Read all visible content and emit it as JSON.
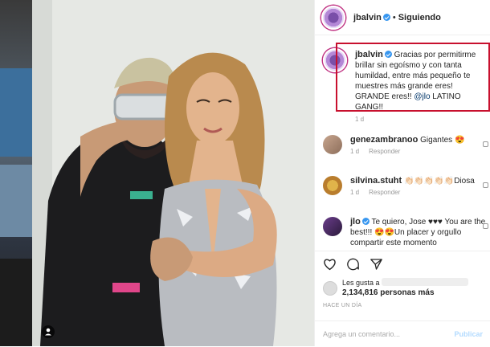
{
  "header": {
    "username": "jbalvin",
    "separator": "•",
    "follow_status": "Siguiendo"
  },
  "caption": {
    "username": "jbalvin",
    "text_before": "Gracias por permitirme brillar sin egoísmo y con tanta humildad, entre más pequeño te muestres más grande eres! GRANDE eres!! ",
    "mention": "@jlo",
    "text_after": " LATINO GANG!!",
    "time": "1 d"
  },
  "comments": [
    {
      "username": "genezambranoo",
      "text": "Gigantes 😍",
      "time": "1 d",
      "reply": "Responder"
    },
    {
      "username": "silvina.stuht",
      "text": "👏🏻👏🏻👏🏻👏🏻👏🏻Diosa",
      "time": "1 d",
      "reply": "Responder"
    },
    {
      "username": "jlo",
      "text": "Te quiero, Jose ♥♥♥ You are the best!!! 😍😍Un placer y orgullo compartir este momento"
    }
  ],
  "likes": {
    "prefix": "Les gusta a",
    "count": "2,134,816 personas más"
  },
  "time_ago": "HACE UN DÍA",
  "comment_input": {
    "placeholder": "Agrega un comentario...",
    "post_label": "Publicar"
  },
  "colors": {
    "highlight": "#c8102e",
    "verified": "#3897f0",
    "mention": "#003569"
  },
  "icons": [
    "heart-icon",
    "comment-icon",
    "share-icon",
    "user-tag-icon",
    "verified-icon"
  ]
}
